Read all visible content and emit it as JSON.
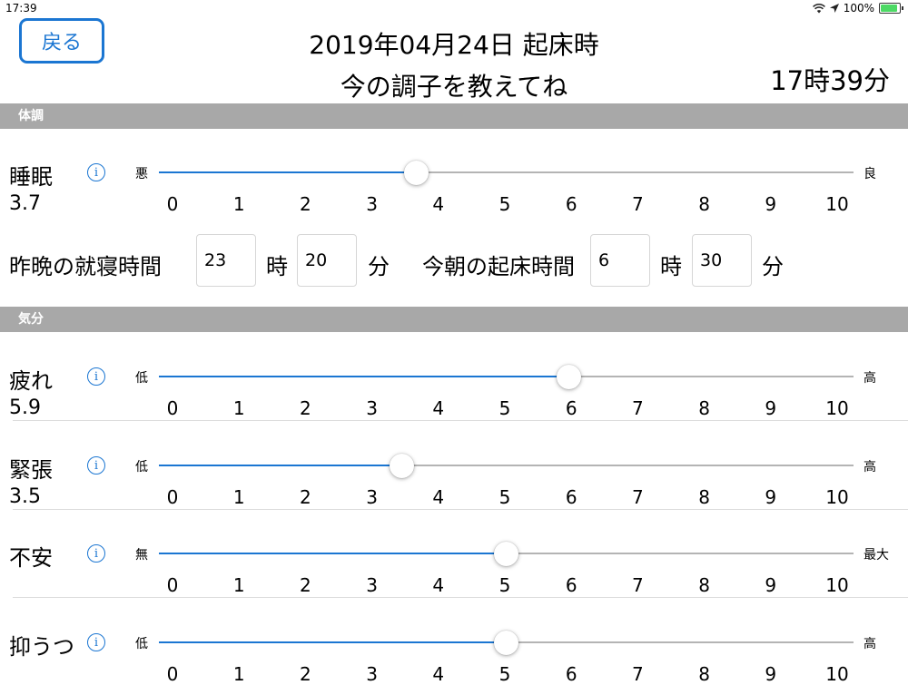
{
  "status_bar": {
    "time": "17:39",
    "battery": "100%"
  },
  "header": {
    "back_label": "戻る",
    "title_line1": "2019年04月24日 起床時",
    "title_line2": "今の調子を教えてね",
    "current_time": "17時39分"
  },
  "sections": [
    {
      "label": "体調"
    },
    {
      "label": "気分"
    }
  ],
  "slider_ticks": [
    "0",
    "1",
    "2",
    "3",
    "4",
    "5",
    "6",
    "7",
    "8",
    "9",
    "10"
  ],
  "sliders": [
    {
      "label": "睡眠",
      "value": 3.7,
      "value_text": "3.7",
      "min_label": "悪",
      "max_label": "良",
      "min": 0,
      "max": 10
    },
    {
      "label": "疲れ",
      "value": 5.9,
      "value_text": "5.9",
      "min_label": "低",
      "max_label": "高",
      "min": 0,
      "max": 10
    },
    {
      "label": "緊張",
      "value": 3.5,
      "value_text": "3.5",
      "min_label": "低",
      "max_label": "高",
      "min": 0,
      "max": 10
    },
    {
      "label": "不安",
      "value": 5,
      "value_text": "",
      "min_label": "無",
      "max_label": "最大",
      "min": 0,
      "max": 10
    },
    {
      "label": "抑うつ",
      "value": 5,
      "value_text": "",
      "min_label": "低",
      "max_label": "高",
      "min": 0,
      "max": 10
    }
  ],
  "sleep_times": {
    "bedtime_label": "昨晩の就寝時間",
    "bedtime_hour": "23",
    "bedtime_minute": "20",
    "wake_label": "今朝の起床時間",
    "wake_hour": "6",
    "wake_minute": "30",
    "hour_unit": "時",
    "minute_unit": "分"
  },
  "info_icon_glyph": "i",
  "colors": {
    "accent": "#1b76d2",
    "section_header": "#a8a8a8",
    "track": "#b4b4b4"
  }
}
